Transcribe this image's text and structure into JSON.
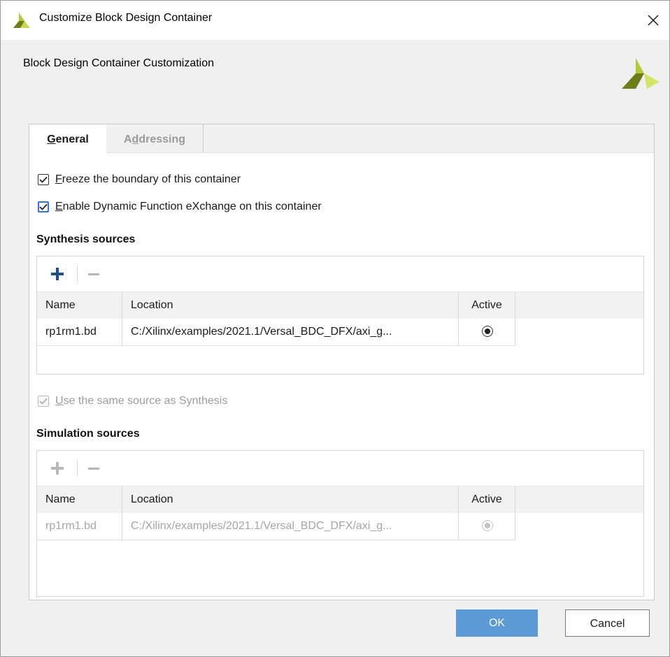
{
  "window": {
    "title": "Customize Block Design Container",
    "close_icon": "close-icon",
    "logo_icon": "xilinx-logo"
  },
  "header": {
    "text": "Block Design Container Customization"
  },
  "tabs": [
    {
      "label_first": "G",
      "label_rest": "eneral",
      "active": true
    },
    {
      "label_pre": "A",
      "label_ul": "d",
      "label_rest": "dressing",
      "active": false
    }
  ],
  "options": {
    "freeze": {
      "ul": "F",
      "rest": "reeze the boundary of this container",
      "checked": true
    },
    "dfx": {
      "ul": "E",
      "rest": "nable Dynamic Function eXchange on this container",
      "checked": true
    },
    "same_source": {
      "ul": "U",
      "rest": "se the same source as Synthesis",
      "checked": true,
      "disabled": true
    }
  },
  "synthesis": {
    "title": "Synthesis sources",
    "columns": [
      "Name",
      "Location",
      "Active"
    ],
    "rows": [
      {
        "name": "rp1rm1.bd",
        "location": "C:/Xilinx/examples/2021.1/Versal_BDC_DFX/axi_g...",
        "active": true
      }
    ]
  },
  "simulation": {
    "title": "Simulation sources",
    "columns": [
      "Name",
      "Location",
      "Active"
    ],
    "rows": [
      {
        "name": "rp1rm1.bd",
        "location": "C:/Xilinx/examples/2021.1/Versal_BDC_DFX/axi_g...",
        "active": true
      }
    ]
  },
  "buttons": {
    "ok": "OK",
    "cancel": "Cancel"
  },
  "colors": {
    "accent": "#5b9ad6",
    "logo_dark": "#6e7d14",
    "logo_light": "#b6c832"
  }
}
